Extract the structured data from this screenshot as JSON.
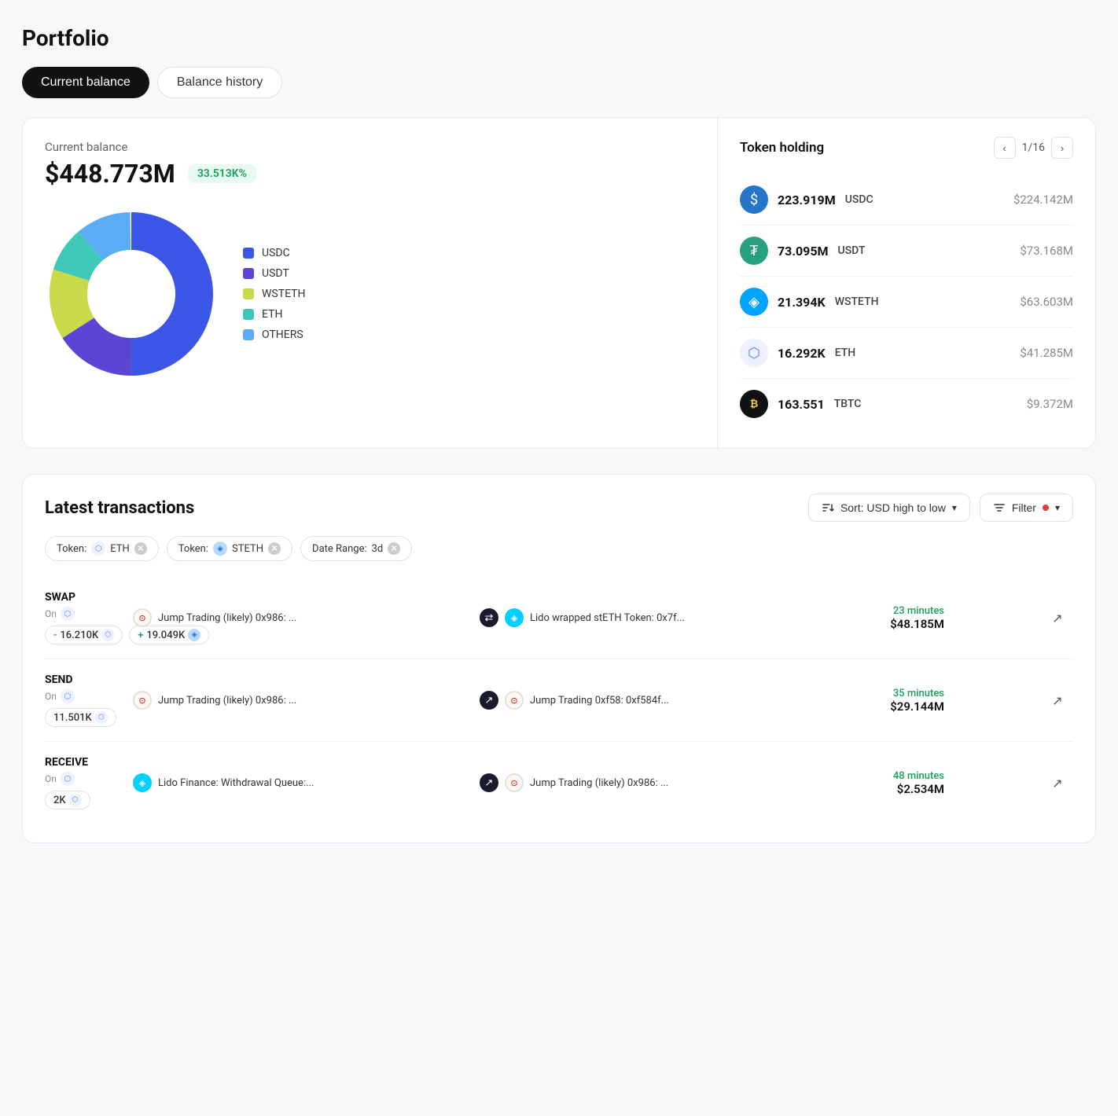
{
  "page": {
    "title": "Portfolio",
    "tabs": [
      {
        "label": "Current balance",
        "active": true
      },
      {
        "label": "Balance history",
        "active": false
      }
    ]
  },
  "balance": {
    "label": "Current balance",
    "amount": "$448.773M",
    "badge": "33.513K%"
  },
  "chart": {
    "legend": [
      {
        "label": "USDC",
        "color": "#3b55e6"
      },
      {
        "label": "USDT",
        "color": "#5c45d4"
      },
      {
        "label": "WSTETH",
        "color": "#c8d94a"
      },
      {
        "label": "ETH",
        "color": "#3ec8b8"
      },
      {
        "label": "OTHERS",
        "color": "#5aacf5"
      }
    ]
  },
  "tokenHolding": {
    "title": "Token holding",
    "pagination": "1/16",
    "tokens": [
      {
        "symbol": "USDC",
        "amount": "223.919M",
        "usd": "$224.142M",
        "iconType": "usdc"
      },
      {
        "symbol": "USDT",
        "amount": "73.095M",
        "usd": "$73.168M",
        "iconType": "usdt"
      },
      {
        "symbol": "WSTETH",
        "amount": "21.394K",
        "usd": "$63.603M",
        "iconType": "wsteth"
      },
      {
        "symbol": "ETH",
        "amount": "16.292K",
        "usd": "$41.285M",
        "iconType": "eth"
      },
      {
        "symbol": "TBTC",
        "amount": "163.551",
        "usd": "$9.372M",
        "iconType": "tbtc"
      }
    ]
  },
  "transactions": {
    "title": "Latest transactions",
    "sort_label": "Sort: USD high to low",
    "filter_label": "Filter",
    "filter_tags": [
      {
        "type": "Token",
        "value": "ETH",
        "iconType": "eth"
      },
      {
        "type": "Token",
        "value": "STETH",
        "iconType": "steth"
      },
      {
        "type": "Date Range",
        "value": "3d",
        "iconType": "none"
      }
    ],
    "rows": [
      {
        "type": "SWAP",
        "on_label": "On",
        "from_address": "Jump Trading (likely) 0x986: ...",
        "to_address": "Lido wrapped stETH Token: 0x7f...",
        "time": "23 minutes",
        "usd": "$48.185M",
        "amounts": [
          {
            "sign": "-",
            "value": "16.210K",
            "iconType": "eth"
          },
          {
            "sign": "+",
            "value": "19.049K",
            "iconType": "steth"
          }
        ],
        "from_icon": "jump",
        "to_icon": "lido",
        "mid_icon": "swap"
      },
      {
        "type": "SEND",
        "on_label": "On",
        "from_address": "Jump Trading (likely) 0x986: ...",
        "to_address": "Jump Trading 0xf58: 0xf584f...",
        "time": "35 minutes",
        "usd": "$29.144M",
        "amounts": [
          {
            "sign": "",
            "value": "11.501K",
            "iconType": "eth"
          }
        ],
        "from_icon": "jump",
        "to_icon": "jump2",
        "mid_icon": "send"
      },
      {
        "type": "RECEIVE",
        "on_label": "On",
        "from_address": "Lido Finance: Withdrawal Queue:...",
        "to_address": "Jump Trading (likely) 0x986: ...",
        "time": "48 minutes",
        "usd": "$2.534M",
        "amounts": [
          {
            "sign": "",
            "value": "2K",
            "iconType": "eth"
          }
        ],
        "from_icon": "lido2",
        "to_icon": "jump3",
        "mid_icon": "receive"
      }
    ]
  }
}
